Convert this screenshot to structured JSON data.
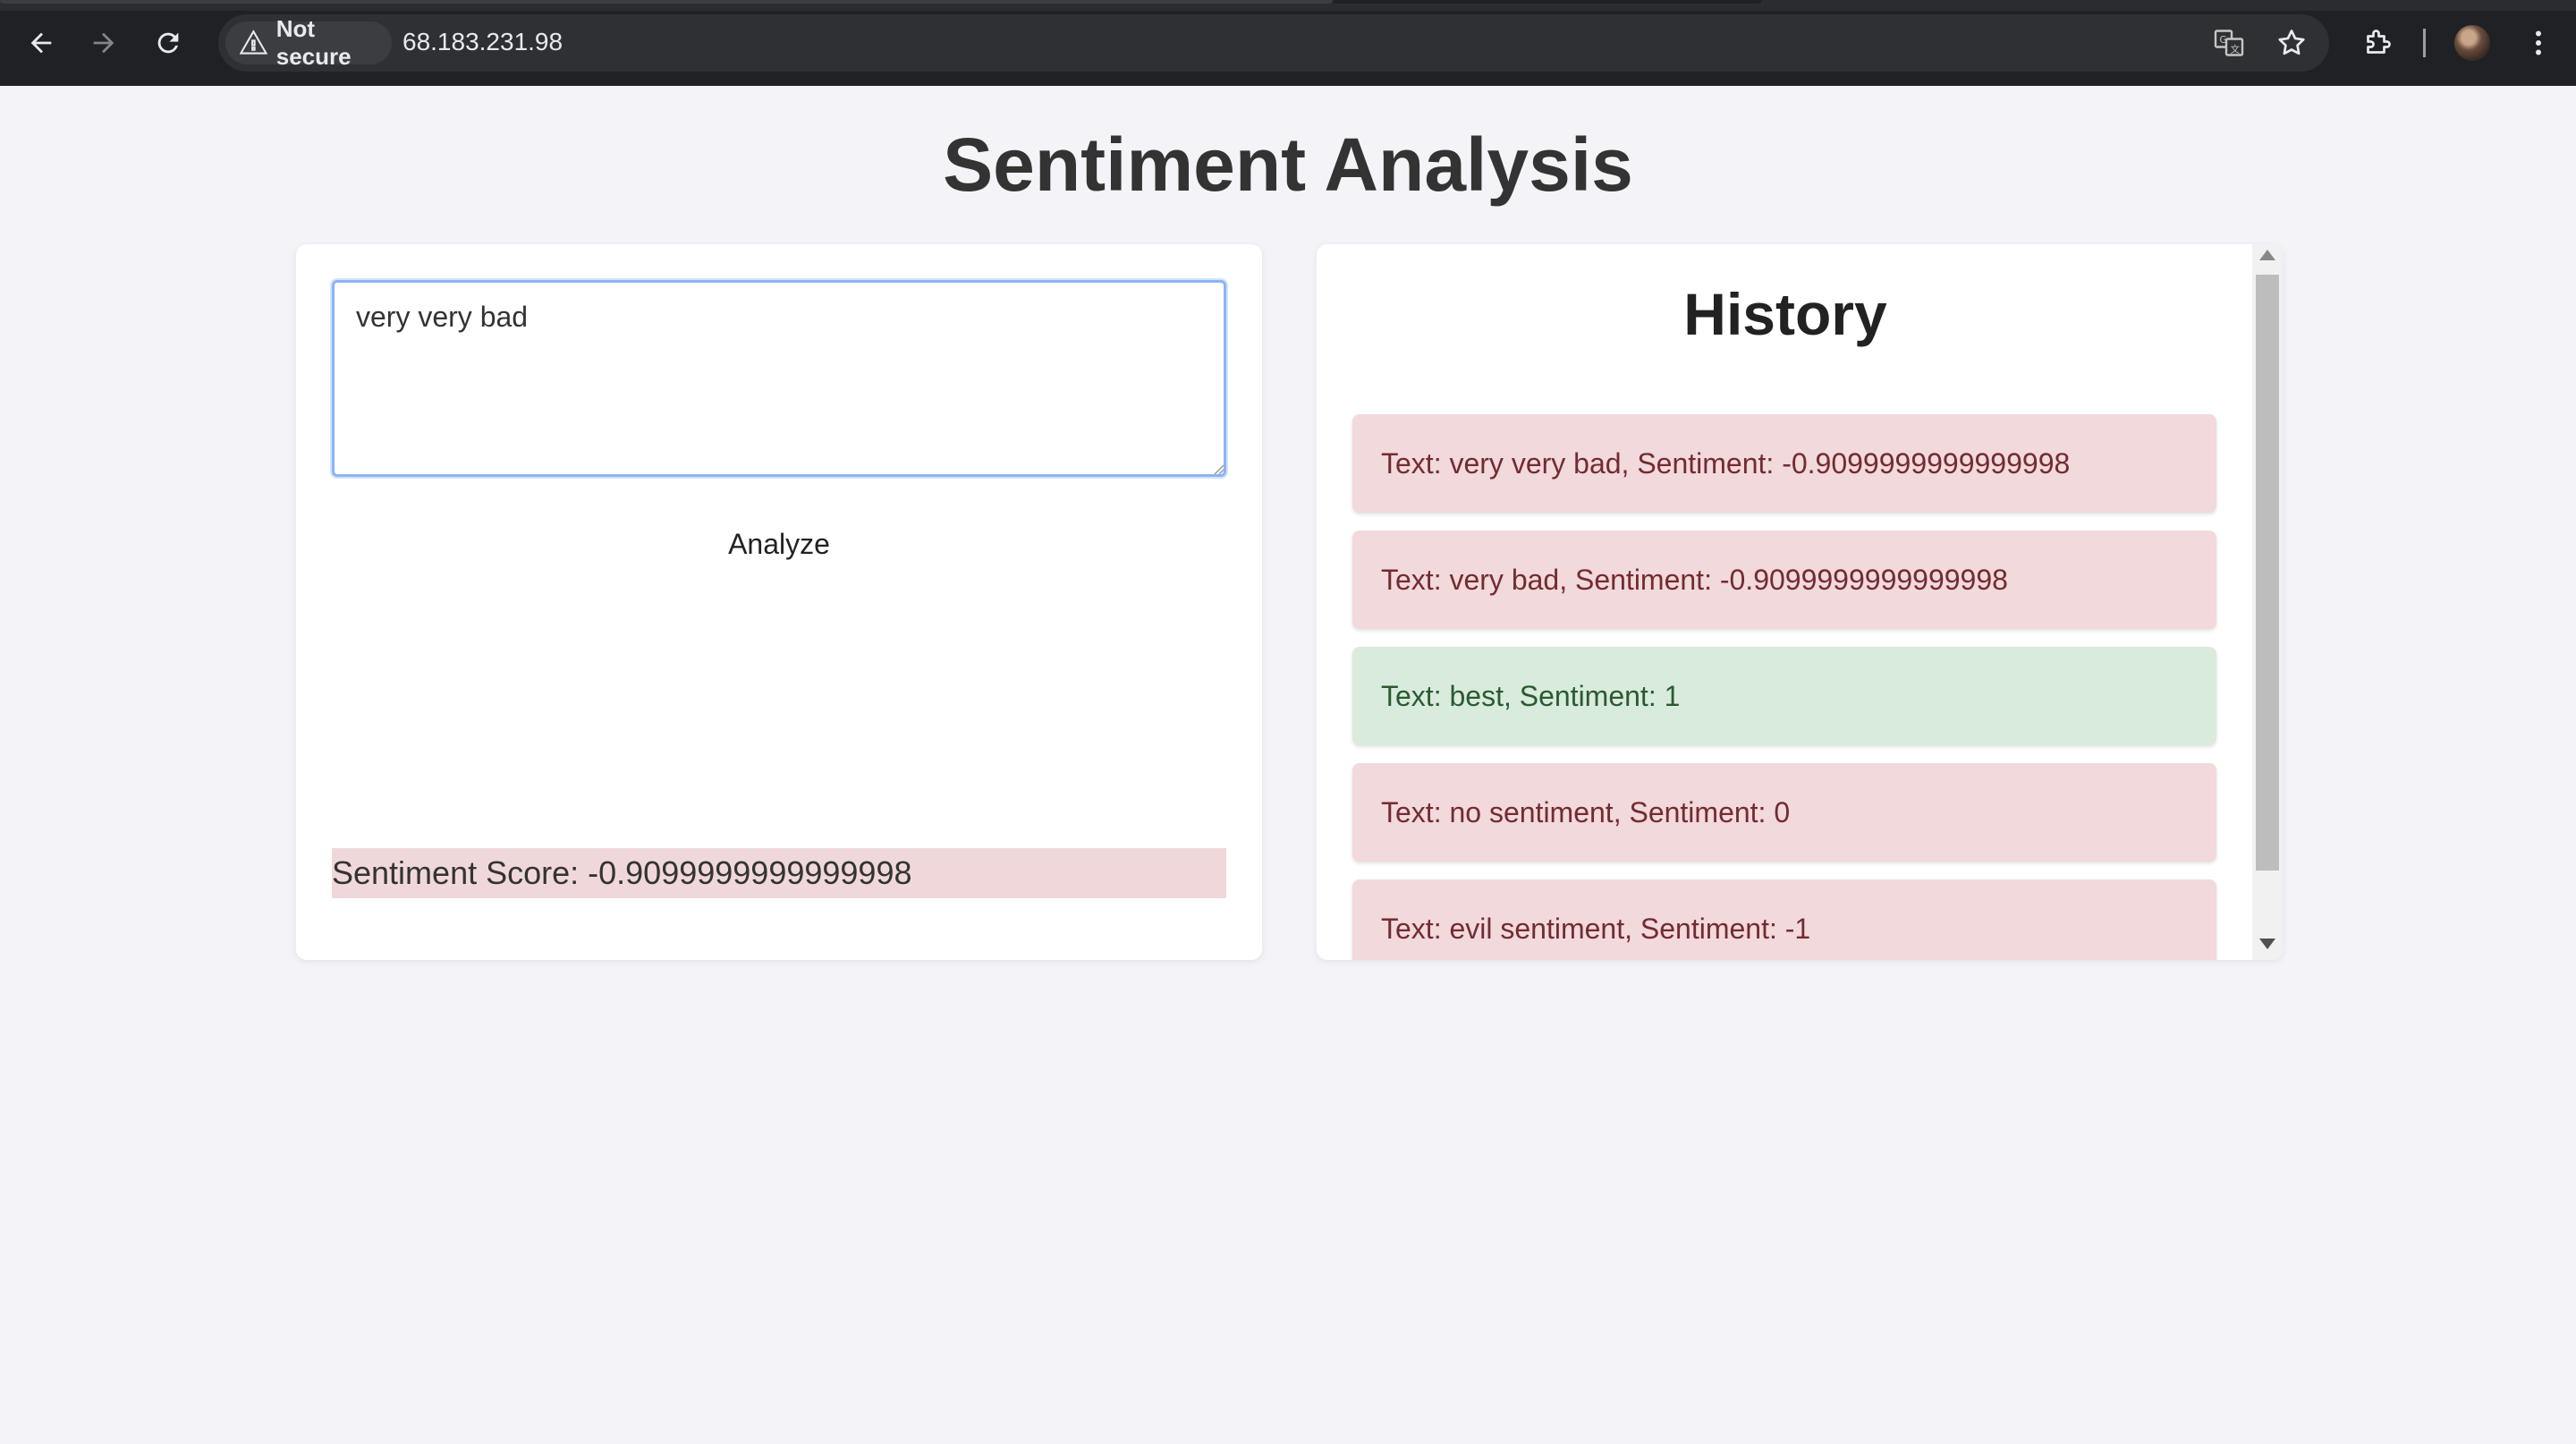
{
  "browser": {
    "security_label": "Not secure",
    "url": "68.183.231.98"
  },
  "page": {
    "title": "Sentiment Analysis"
  },
  "input": {
    "value": "very very bad",
    "analyze_label": "Analyze"
  },
  "result": {
    "score_text": "Sentiment Score: -0.9099999999999998",
    "status": "negative",
    "color": "#f0d8da"
  },
  "history": {
    "title": "History",
    "items": [
      {
        "text": "Text: very very bad, Sentiment: -0.9099999999999998",
        "tone": "negative"
      },
      {
        "text": "Text: very bad, Sentiment: -0.9099999999999998",
        "tone": "negative"
      },
      {
        "text": "Text: best, Sentiment: 1",
        "tone": "positive"
      },
      {
        "text": "Text: no sentiment, Sentiment: 0",
        "tone": "negative"
      },
      {
        "text": "Text: evil sentiment, Sentiment: -1",
        "tone": "negative"
      }
    ]
  },
  "colors": {
    "negative_bg": "#f1d9dc",
    "positive_bg": "#d9ebdd",
    "page_bg": "#f4f4f8"
  }
}
